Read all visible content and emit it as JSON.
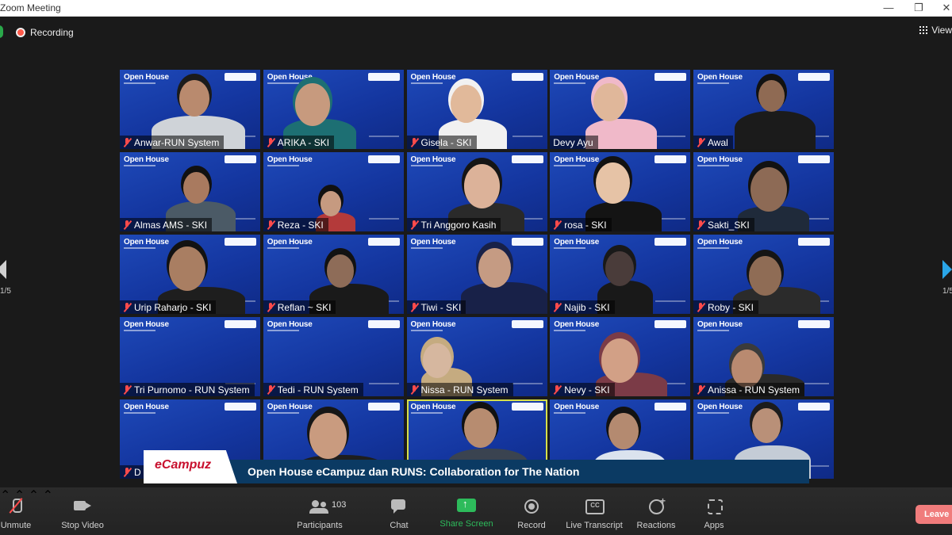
{
  "window": {
    "title": "Zoom Meeting",
    "controls": [
      "—",
      "❐",
      "✕"
    ]
  },
  "recording": {
    "label": "Recording"
  },
  "view": {
    "label": "View"
  },
  "pagination": {
    "left": "1/5",
    "right": "1/5"
  },
  "tile_banner": "Open House",
  "participants": [
    {
      "name": "Anwar-RUN System",
      "muted": true
    },
    {
      "name": "ARIKA - SKI",
      "muted": true
    },
    {
      "name": "Gisela - SKI",
      "muted": true
    },
    {
      "name": "Devy Ayu",
      "muted": false
    },
    {
      "name": "Awal",
      "muted": true
    },
    {
      "name": "Almas AMS - SKI",
      "muted": true
    },
    {
      "name": "Reza - SKI",
      "muted": true
    },
    {
      "name": "Tri Anggoro Kasih",
      "muted": true
    },
    {
      "name": "rosa - SKI",
      "muted": true
    },
    {
      "name": "Sakti_SKI",
      "muted": true
    },
    {
      "name": "Urip Raharjo - SKI",
      "muted": true
    },
    {
      "name": "Reflan ~ SKI",
      "muted": true
    },
    {
      "name": "Tiwi - SKI",
      "muted": true
    },
    {
      "name": "Najib - SKI",
      "muted": true
    },
    {
      "name": "Roby - SKI",
      "muted": true
    },
    {
      "name": "Tri Purnomo - RUN System",
      "muted": true
    },
    {
      "name": "Tedi - RUN System",
      "muted": true
    },
    {
      "name": "Nissa - RUN System",
      "muted": true
    },
    {
      "name": "Nevy - SKI",
      "muted": true
    },
    {
      "name": "Anissa - RUN System",
      "muted": true
    },
    {
      "name": "D",
      "muted": true
    },
    {
      "name": "",
      "muted": false
    },
    {
      "name": "",
      "muted": false
    },
    {
      "name": "",
      "muted": false
    },
    {
      "name": "",
      "muted": false
    }
  ],
  "lower_third": {
    "brand": "eCampuz",
    "caption": "Open House eCampuz dan RUNS: Collaboration for The Nation"
  },
  "toolbar": {
    "unmute": "Unmute",
    "stop_video": "Stop Video",
    "participants": "Participants",
    "participants_count": "103",
    "chat": "Chat",
    "share_screen": "Share Screen",
    "record": "Record",
    "live_transcript": "Live Transcript",
    "reactions": "Reactions",
    "apps": "Apps",
    "leave": "Leave"
  },
  "colors": {
    "accent_green": "#2dbb5b",
    "tile_blue": "#1a3faa",
    "speaker_outline": "#d7e04a",
    "leave_red": "#f07c7c"
  }
}
